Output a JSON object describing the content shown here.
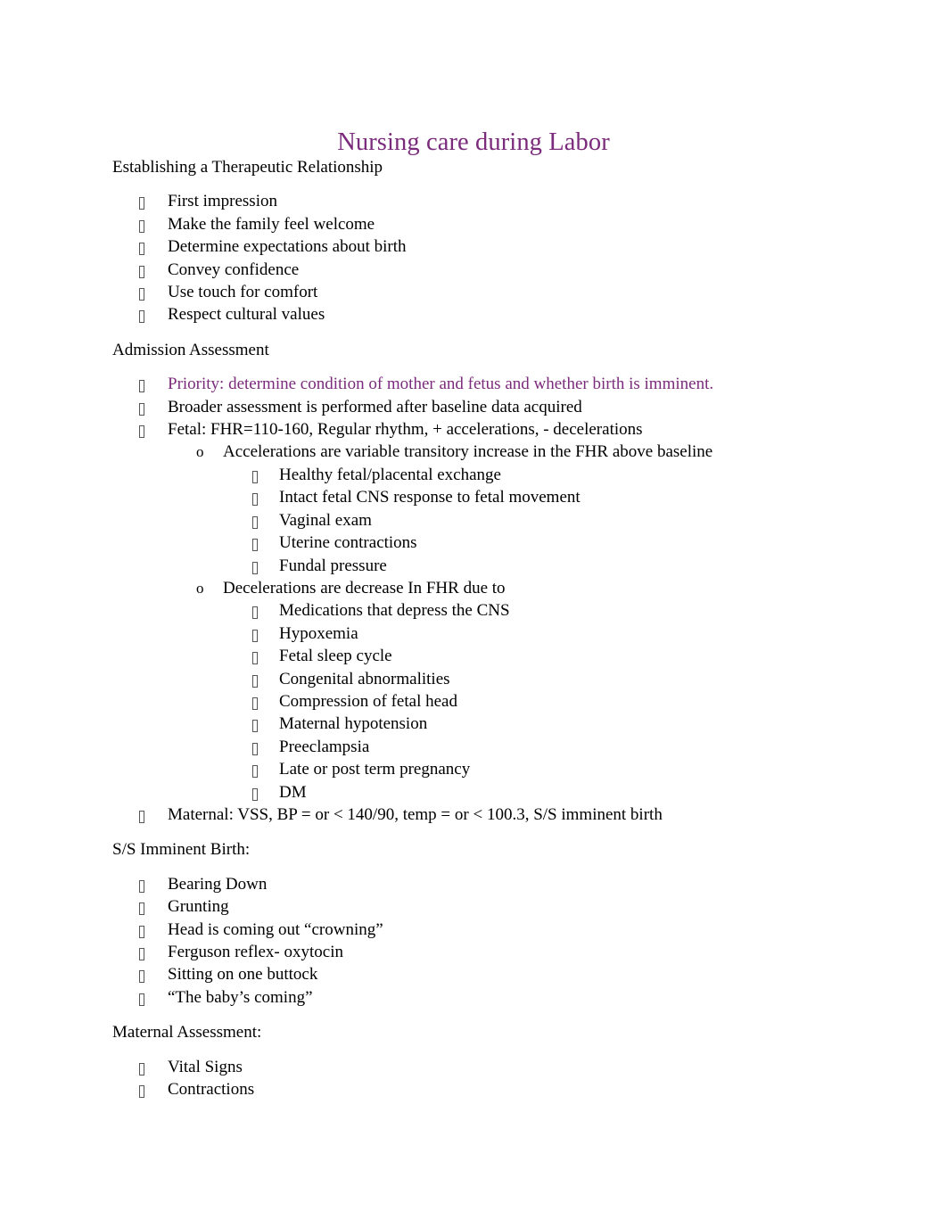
{
  "document": {
    "title": "Nursing care during Labor",
    "title_color": "#7B2B7B",
    "accent_color": "#7B2B7B",
    "background_color": "#FFFFFF",
    "text_color": "#000000"
  },
  "sections": [
    {
      "heading": "Establishing a Therapeutic Relationship",
      "items": [
        {
          "level": 1,
          "marker": "wingdings-box",
          "text": "First impression"
        },
        {
          "level": 1,
          "marker": "wingdings-box",
          "text": "Make the family feel welcome"
        },
        {
          "level": 1,
          "marker": "wingdings-box",
          "text": "Determine expectations about birth"
        },
        {
          "level": 1,
          "marker": "wingdings-box",
          "text": "Convey confidence"
        },
        {
          "level": 1,
          "marker": "wingdings-box",
          "text": "Use touch for comfort"
        },
        {
          "level": 1,
          "marker": "wingdings-box",
          "text": "Respect cultural values"
        }
      ]
    },
    {
      "heading": "Admission Assessment",
      "items": [
        {
          "level": 1,
          "marker": "wingdings-box",
          "text": "Priority: determine condition of mother and fetus and whether birth is imminent.",
          "color": "#7B2B7B"
        },
        {
          "level": 1,
          "marker": "wingdings-box",
          "text": "Broader assessment is performed after baseline data acquired"
        },
        {
          "level": 1,
          "marker": "wingdings-box",
          "text": "Fetal: FHR=110-160, Regular rhythm, + accelerations, - decelerations"
        },
        {
          "level": 2,
          "marker": "o",
          "text": "Accelerations are variable transitory increase in the FHR above baseline"
        },
        {
          "level": 3,
          "marker": "wingdings-box",
          "text": "Healthy fetal/placental exchange"
        },
        {
          "level": 3,
          "marker": "wingdings-box",
          "text": "Intact fetal CNS response to fetal movement"
        },
        {
          "level": 3,
          "marker": "wingdings-box",
          "text": "Vaginal exam"
        },
        {
          "level": 3,
          "marker": "wingdings-box",
          "text": "Uterine contractions"
        },
        {
          "level": 3,
          "marker": "wingdings-box",
          "text": "Fundal pressure"
        },
        {
          "level": 2,
          "marker": "o",
          "text": "Decelerations are decrease In FHR due to"
        },
        {
          "level": 3,
          "marker": "wingdings-box",
          "text": "Medications that depress the CNS"
        },
        {
          "level": 3,
          "marker": "wingdings-box",
          "text": "Hypoxemia"
        },
        {
          "level": 3,
          "marker": "wingdings-box",
          "text": "Fetal sleep cycle"
        },
        {
          "level": 3,
          "marker": "wingdings-box",
          "text": "Congenital abnormalities"
        },
        {
          "level": 3,
          "marker": "wingdings-box",
          "text": "Compression of fetal head"
        },
        {
          "level": 3,
          "marker": "wingdings-box",
          "text": "Maternal hypotension"
        },
        {
          "level": 3,
          "marker": "wingdings-box",
          "text": "Preeclampsia"
        },
        {
          "level": 3,
          "marker": "wingdings-box",
          "text": "Late or post term pregnancy"
        },
        {
          "level": 3,
          "marker": "wingdings-box",
          "text": "DM"
        },
        {
          "level": 1,
          "marker": "wingdings-box",
          "text": "Maternal: VSS, BP = or < 140/90, temp = or < 100.3, S/S imminent birth"
        }
      ]
    },
    {
      "heading": "S/S Imminent Birth:",
      "items": [
        {
          "level": 1,
          "marker": "wingdings-box",
          "text": "Bearing Down"
        },
        {
          "level": 1,
          "marker": "wingdings-box",
          "text": "Grunting"
        },
        {
          "level": 1,
          "marker": "wingdings-box",
          "text": "Head is coming out “crowning”"
        },
        {
          "level": 1,
          "marker": "wingdings-box",
          "text": "Ferguson reflex- oxytocin"
        },
        {
          "level": 1,
          "marker": "wingdings-box",
          "text": "Sitting on one buttock"
        },
        {
          "level": 1,
          "marker": "wingdings-box",
          "text": "“The baby’s coming”"
        }
      ]
    },
    {
      "heading": "Maternal Assessment:",
      "items": [
        {
          "level": 1,
          "marker": "wingdings-box",
          "text": "Vital Signs"
        },
        {
          "level": 1,
          "marker": "wingdings-box",
          "text": "Contractions"
        }
      ]
    }
  ]
}
